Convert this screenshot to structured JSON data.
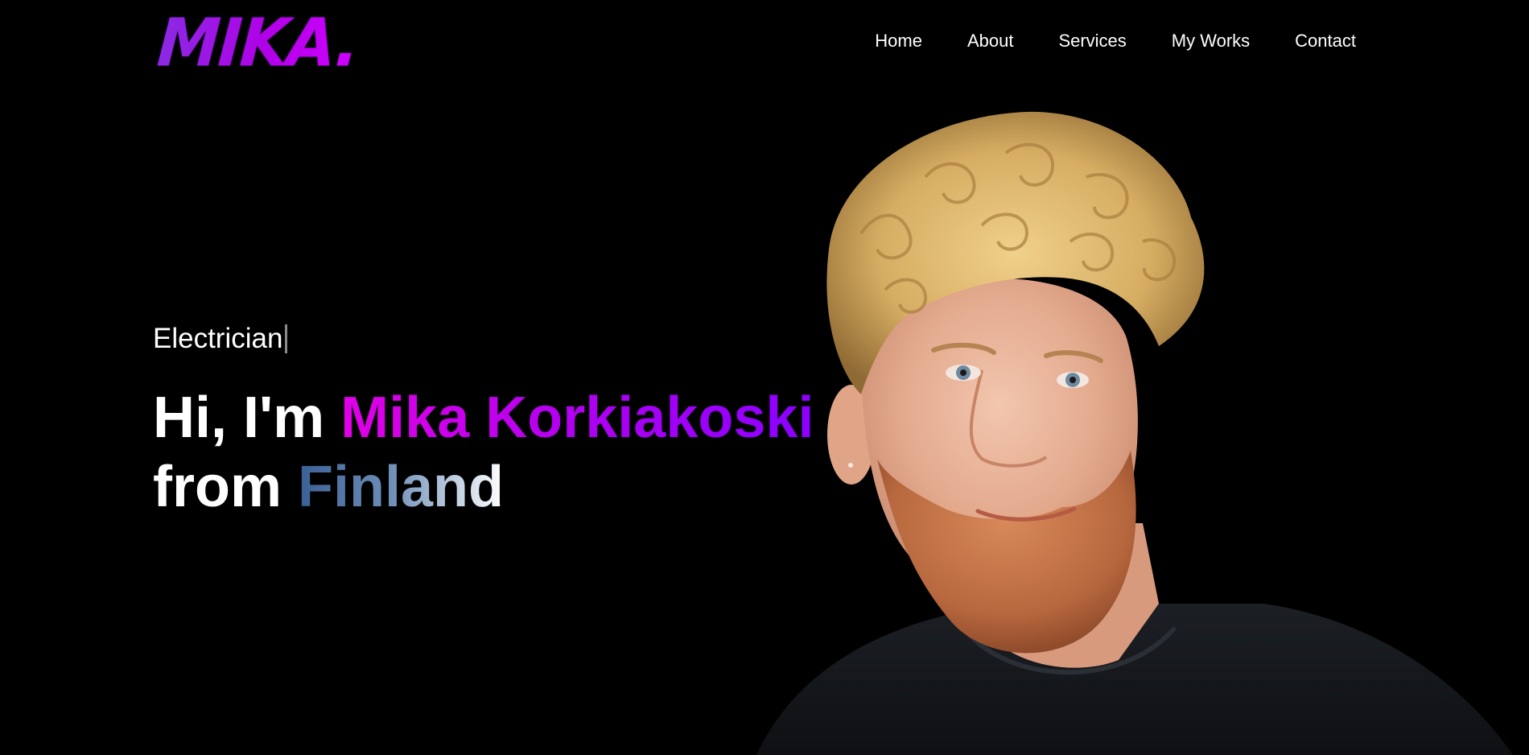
{
  "header": {
    "logo_text": "MIKA.",
    "nav": [
      {
        "label": "Home"
      },
      {
        "label": "About"
      },
      {
        "label": "Services"
      },
      {
        "label": "My Works"
      },
      {
        "label": "Contact"
      }
    ]
  },
  "hero": {
    "role": "Electrician",
    "greeting": "Hi, I'm",
    "name": "Mika Korkiakoski",
    "from": "from",
    "country": "Finland"
  },
  "colors": {
    "background": "#000000",
    "accent_purple": "#b000f0",
    "accent_magenta": "#e000e6",
    "accent_violet": "#8a00ff",
    "country_blue": "#3a5f95"
  },
  "icons": {
    "portrait": "portrait-photo"
  }
}
